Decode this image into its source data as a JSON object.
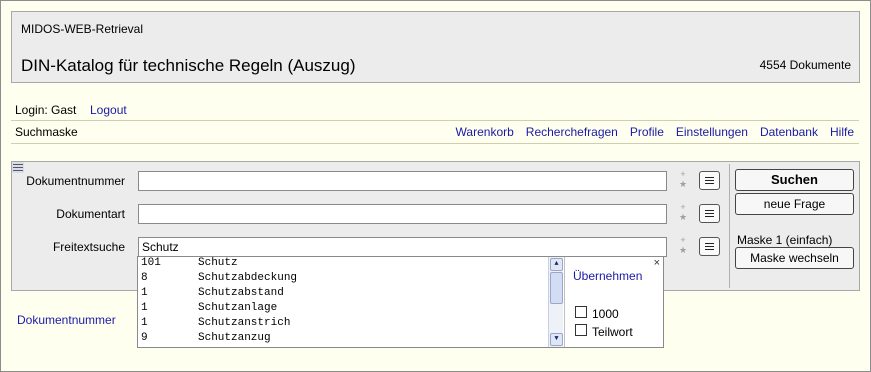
{
  "header": {
    "app_name": "MIDOS-WEB-Retrieval",
    "title": "DIN-Katalog für technische Regeln (Auszug)",
    "doc_count": "4554 Dokumente"
  },
  "session": {
    "login": "Login: Gast",
    "logout": "Logout"
  },
  "page_label": "Suchmaske",
  "nav": [
    "Warenkorb",
    "Recherchefragen",
    "Profile",
    "Einstellungen",
    "Datenbank",
    "Hilfe"
  ],
  "form": {
    "fields": [
      {
        "label": "Dokumentnummer",
        "value": ""
      },
      {
        "label": "Dokumentart",
        "value": ""
      },
      {
        "label": "Freitextsuche",
        "value": "Schutz"
      }
    ],
    "stars": "+ ★",
    "search_button": "Suchen",
    "new_query_button": "neue Frage",
    "mask_label": "Maske 1 (einfach)",
    "switch_mask_button": "Maske wechseln"
  },
  "autocomplete": {
    "items": [
      {
        "count": "101",
        "term": "Schutz"
      },
      {
        "count": "8",
        "term": "Schutzabdeckung"
      },
      {
        "count": "1",
        "term": "Schutzabstand"
      },
      {
        "count": "1",
        "term": "Schutzanlage"
      },
      {
        "count": "1",
        "term": "Schutzanstrich"
      },
      {
        "count": "9",
        "term": "Schutzanzug"
      }
    ],
    "close": "×",
    "apply": "Übernehmen",
    "options": [
      "1000",
      "Teilwort"
    ],
    "scroll_up": "▲",
    "scroll_down": "▼"
  },
  "bottom_link": "Dokumentnummer"
}
